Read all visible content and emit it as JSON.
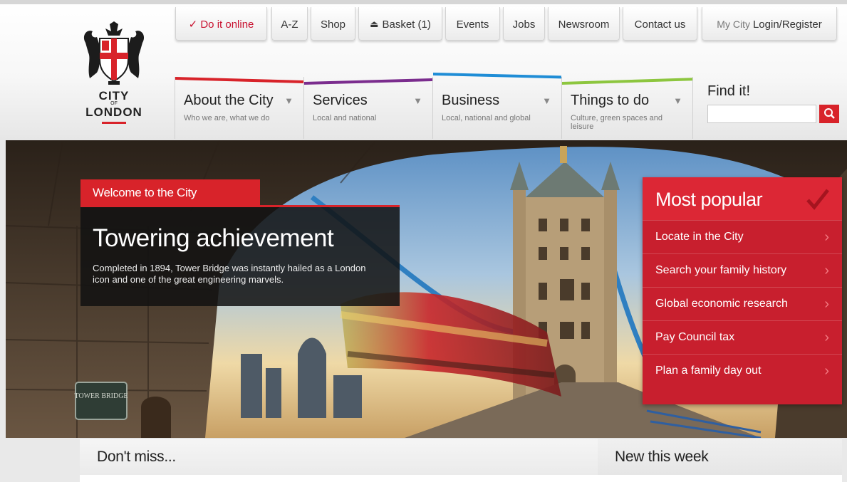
{
  "logo": {
    "line1": "CITY",
    "line2": "OF",
    "line3": "LONDON"
  },
  "utility_nav": {
    "do_it_online": "✓ Do it online",
    "az": "A-Z",
    "shop": "Shop",
    "basket": "Basket (1)",
    "events": "Events",
    "jobs": "Jobs",
    "newsroom": "Newsroom",
    "contact": "Contact us",
    "my_city": "My City",
    "login": "Login/Register"
  },
  "main_nav": [
    {
      "title": "About the City",
      "sub": "Who we are, what we do",
      "color": "#d8232a"
    },
    {
      "title": "Services",
      "sub": "Local and national",
      "color": "#7b2d8e"
    },
    {
      "title": "Business",
      "sub": "Local, national and global",
      "color": "#1f8dd6"
    },
    {
      "title": "Things to do",
      "sub": "Culture, green spaces and leisure",
      "color": "#8dc63f"
    }
  ],
  "search": {
    "label": "Find it!",
    "value": ""
  },
  "hero": {
    "welcome": "Welcome to the City",
    "headline": "Towering achievement",
    "body": "Completed in 1894, Tower Bridge was instantly hailed as a London icon and one of the great engineering marvels.",
    "sign": "TOWER BRIDGE"
  },
  "most_popular": {
    "title": "Most popular",
    "items": [
      "Locate in the City",
      "Search your family history",
      "Global economic research",
      "Pay Council tax",
      "Plan a family day out"
    ]
  },
  "sections": {
    "dont_miss": "Don't miss...",
    "new_this_week": "New this week"
  },
  "colors": {
    "brand_red": "#d8232a",
    "popular_red": "#c81f2e"
  }
}
